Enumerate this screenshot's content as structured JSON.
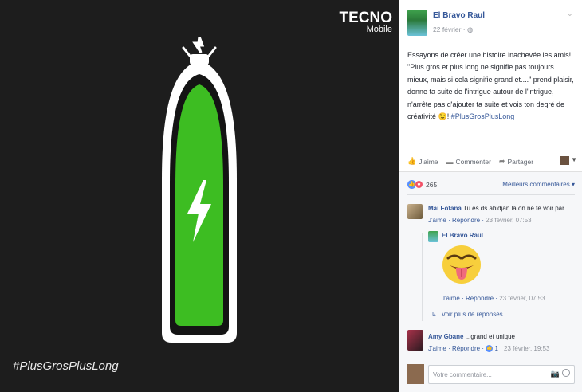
{
  "photo": {
    "brand_name": "TECNO",
    "brand_sub": "Mobile",
    "hashtag": "#PlusGrosPlusLong"
  },
  "post": {
    "author": "El Bravo Raul",
    "date": "22 février · ",
    "text_main": "Essayons de créer une histoire inachevée les amis! \"Plus gros et plus long ne signifie pas toujours mieux, mais si cela signifie grand et....\" prend plaisir, donne ta suite de l'intrigue autour de l'intrigue, n'arrête pas d'ajouter ta suite et vois ton degré de créativité ",
    "emoji": "😉",
    "text_end": "! ",
    "hashtag": "#PlusGrosPlusLong"
  },
  "actions": {
    "like": "J'aime",
    "comment": "Commenter",
    "share": "Partager"
  },
  "reactions": {
    "count": "265",
    "best_comments": "Meilleurs commentaires ▾"
  },
  "comments": [
    {
      "author": "Mai Fofana",
      "text": " Tu es ds abidjan la on ne te voir par",
      "like": "J'aime",
      "reply": "Répondre",
      "time": "23 février, 07:53"
    },
    {
      "author": "El Bravo Raul",
      "text": "",
      "like": "J'aime",
      "reply": "Répondre",
      "time": "23 février, 07:53"
    },
    {
      "author": "Amy Gbane",
      "text": " ...grand et unique",
      "like": "J'aime",
      "reply": "Répondre",
      "likes": "1",
      "time": "23 février, 19:53"
    }
  ],
  "more_replies": "Voir plus de réponses",
  "write": {
    "placeholder": "Votre commentaire..."
  },
  "colors": {
    "link": "#365899",
    "battery_green": "#3dbd22",
    "panel_bg": "#ffffff",
    "photo_bg": "#1d1d1d"
  }
}
